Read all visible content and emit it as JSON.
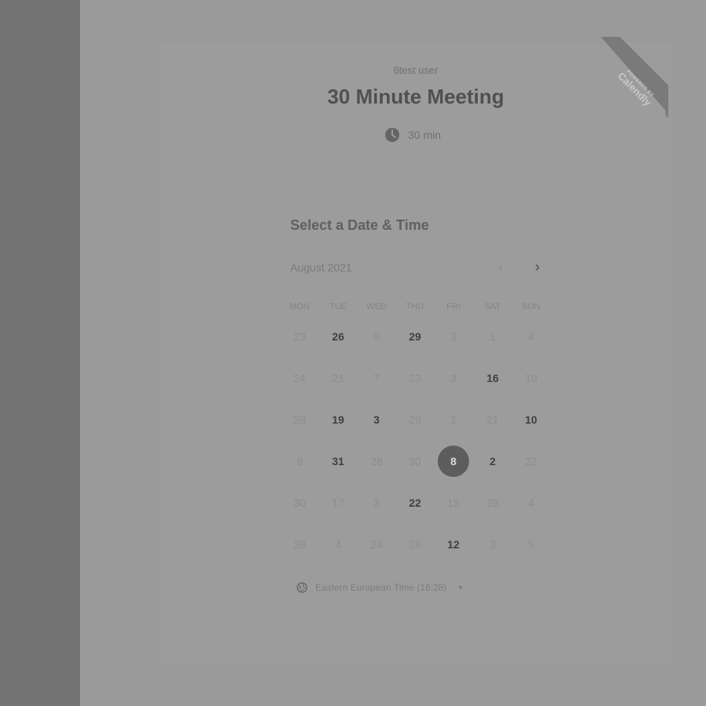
{
  "event": {
    "user": "6test user",
    "title": "30 Minute Meeting",
    "duration": "30 min"
  },
  "badge": {
    "line1": "POWERED BY",
    "line2": "Calendly"
  },
  "calendar": {
    "section_title": "Select a Date & Time",
    "month_label": "August 2021",
    "days_of_week": [
      "MON",
      "TUE",
      "WED",
      "THU",
      "FRI",
      "SAT",
      "SUN"
    ],
    "weeks": [
      [
        {
          "d": "23"
        },
        {
          "d": "26",
          "a": true
        },
        {
          "d": "9"
        },
        {
          "d": "29",
          "a": true
        },
        {
          "d": "3"
        },
        {
          "d": "1"
        },
        {
          "d": "4"
        }
      ],
      [
        {
          "d": "24"
        },
        {
          "d": "21"
        },
        {
          "d": "7"
        },
        {
          "d": "23"
        },
        {
          "d": "3"
        },
        {
          "d": "16",
          "a": true
        },
        {
          "d": "10"
        }
      ],
      [
        {
          "d": "28"
        },
        {
          "d": "19",
          "a": true
        },
        {
          "d": "3",
          "a": true
        },
        {
          "d": "29"
        },
        {
          "d": "1"
        },
        {
          "d": "21"
        },
        {
          "d": "10",
          "a": true
        }
      ],
      [
        {
          "d": "9"
        },
        {
          "d": "31",
          "a": true
        },
        {
          "d": "28"
        },
        {
          "d": "30"
        },
        {
          "d": "8",
          "s": true
        },
        {
          "d": "2",
          "a": true
        },
        {
          "d": "22"
        }
      ],
      [
        {
          "d": "30"
        },
        {
          "d": "17"
        },
        {
          "d": "3"
        },
        {
          "d": "22",
          "a": true
        },
        {
          "d": "15"
        },
        {
          "d": "28"
        },
        {
          "d": "4"
        }
      ],
      [
        {
          "d": "28"
        },
        {
          "d": "4"
        },
        {
          "d": "24"
        },
        {
          "d": "28"
        },
        {
          "d": "12",
          "a": true
        },
        {
          "d": "3"
        },
        {
          "d": "5"
        }
      ]
    ],
    "timezone_label": "Eastern European Time (16:28)"
  },
  "colors": {
    "overlay": "#9a9a9a",
    "selected_day": "#5d5d5d"
  }
}
